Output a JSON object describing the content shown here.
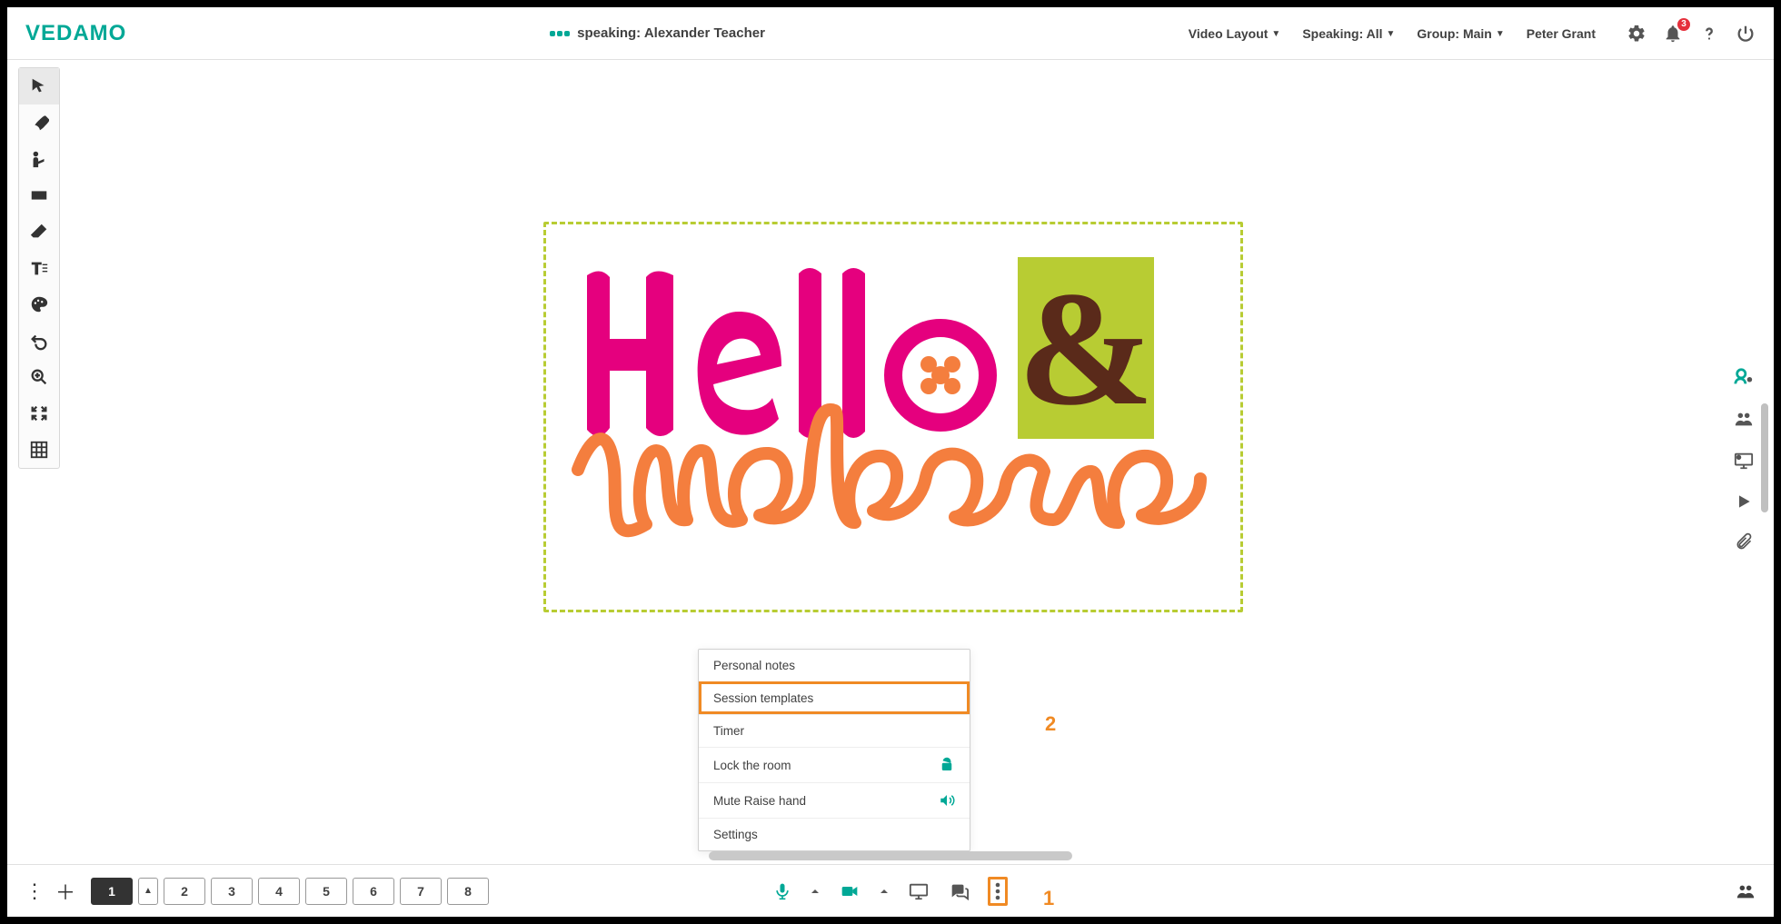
{
  "brand": "VEDAMO",
  "header": {
    "speaking_label": "speaking:",
    "speaking_name": "Alexander Teacher",
    "menu": {
      "video_layout": "Video Layout",
      "speaking": "Speaking: All",
      "group": "Group: Main",
      "user": "Peter Grant"
    },
    "notifications_count": "3"
  },
  "left_toolbar": {
    "pointer": "pointer",
    "brush": "brush",
    "presenter": "presenter",
    "shape": "shape",
    "eraser": "eraser",
    "text": "text",
    "colors": "colors",
    "undo": "undo",
    "zoom": "zoom",
    "fit": "fit",
    "grid": "grid"
  },
  "right_sidebar": {
    "participant_self": "participant-self",
    "participants": "participants",
    "screen_share": "screen-share",
    "play": "play",
    "attach": "attach"
  },
  "canvas_image": {
    "line1": "Hello",
    "amp": "&",
    "line2": "welcome"
  },
  "popup": {
    "items": [
      {
        "label": "Personal notes",
        "icon": null
      },
      {
        "label": "Session templates",
        "icon": null
      },
      {
        "label": "Timer",
        "icon": null
      },
      {
        "label": "Lock the room",
        "icon": "unlock"
      },
      {
        "label": "Mute Raise hand",
        "icon": "volume"
      },
      {
        "label": "Settings",
        "icon": null
      }
    ],
    "highlighted_index": 1
  },
  "callouts": {
    "one": "1",
    "two": "2"
  },
  "bottom": {
    "pages": [
      "1",
      "2",
      "3",
      "4",
      "5",
      "6",
      "7",
      "8"
    ],
    "active_page_index": 0
  }
}
